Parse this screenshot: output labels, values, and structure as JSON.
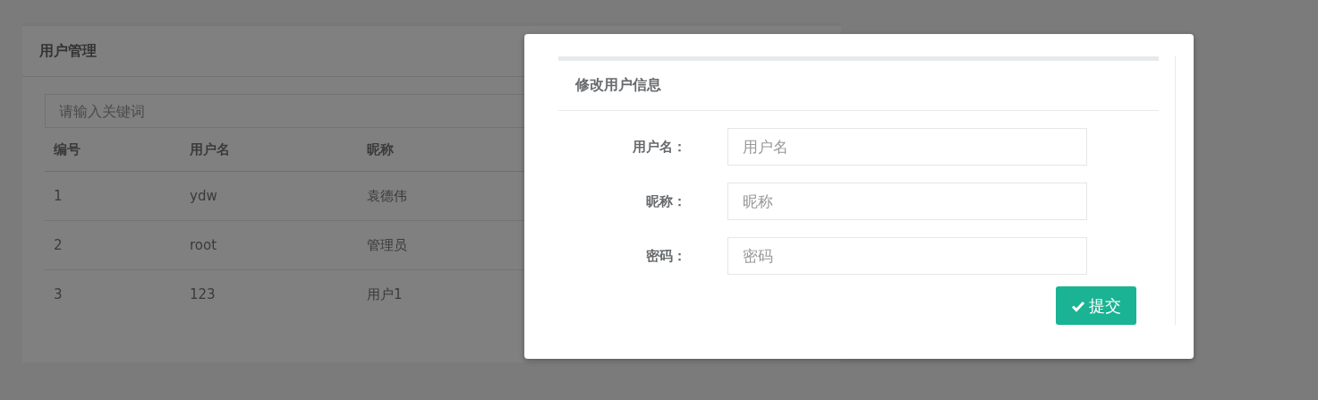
{
  "panel": {
    "title": "用户管理",
    "search": {
      "placeholder": "请输入关键词"
    },
    "table": {
      "columns": [
        "编号",
        "用户名",
        "昵称"
      ],
      "rows": [
        [
          "1",
          "ydw",
          "袁德伟"
        ],
        [
          "2",
          "root",
          "管理员"
        ],
        [
          "3",
          "123",
          "用户1"
        ]
      ]
    }
  },
  "dialog": {
    "title": "修改用户信息",
    "fields": [
      {
        "label": "用户名：",
        "placeholder": "用户名"
      },
      {
        "label": "昵称：",
        "placeholder": "昵称"
      },
      {
        "label": "密码：",
        "placeholder": "密码"
      }
    ],
    "submit": "提交"
  }
}
